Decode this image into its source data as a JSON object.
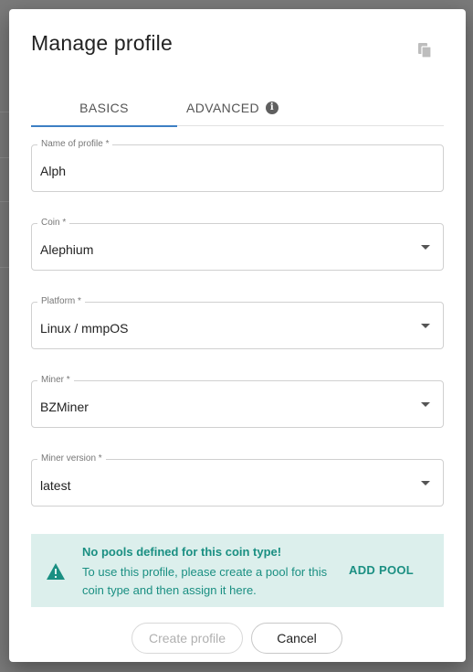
{
  "dialog": {
    "title": "Manage profile",
    "copy_icon": "copy-icon"
  },
  "tabs": [
    {
      "label": "BASICS",
      "active": true
    },
    {
      "label": "ADVANCED",
      "icon": "info-icon",
      "active": false
    }
  ],
  "info_glyph": "i",
  "fields": {
    "name": {
      "label": "Name of profile *",
      "value": "Alph"
    },
    "coin": {
      "label": "Coin *",
      "value": "Alephium"
    },
    "platform": {
      "label": "Platform *",
      "value": "Linux / mmpOS"
    },
    "miner": {
      "label": "Miner *",
      "value": "BZMiner"
    },
    "miner_version": {
      "label": "Miner version *",
      "value": "latest"
    }
  },
  "alert": {
    "icon": "warning-icon",
    "title": "No pools defined for this coin type!",
    "body": "To use this profile, please create a pool for this coin type and then assign it here.",
    "action_label": "ADD POOL",
    "color": "#1a8f82",
    "background": "#dcefec"
  },
  "buttons": {
    "create_label": "Create profile",
    "create_disabled": true,
    "cancel_label": "Cancel"
  },
  "colors": {
    "accent": "#3d7fc4"
  }
}
